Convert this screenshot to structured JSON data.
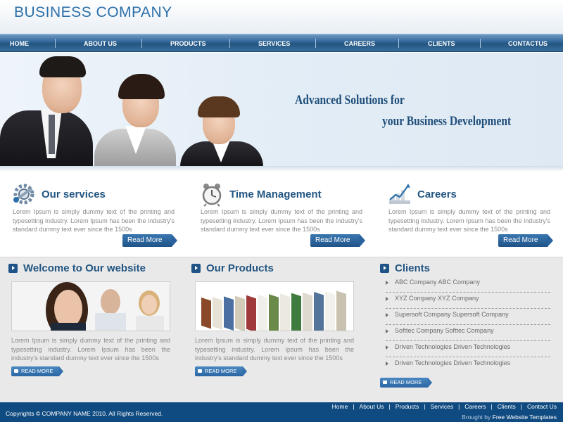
{
  "brand": {
    "title": "BUSINESS COMPANY"
  },
  "nav": {
    "items": [
      {
        "label": "HOME"
      },
      {
        "label": "ABOUT US"
      },
      {
        "label": "PRODUCTS"
      },
      {
        "label": "SERVICES"
      },
      {
        "label": "CAREERS"
      },
      {
        "label": "CLIENTS"
      },
      {
        "label": "CONTACTUS"
      }
    ]
  },
  "banner": {
    "line1": "Advanced Solutions for",
    "line2": "your Business Development"
  },
  "services": [
    {
      "title": "Our services",
      "icon": "gear-wrench-icon",
      "text": "Lorem Ipsum is simply dummy text of the printing and typesetting industry. Lorem Ipsum has been the industry's standard dummy text ever since the 1500s",
      "button": "Read More"
    },
    {
      "title": "Time Management",
      "icon": "alarm-clock-icon",
      "text": "Lorem Ipsum is simply dummy text of the printing and typesetting industry. Lorem Ipsum has been the industry's standard dummy text ever since the 1500s",
      "button": "Read More"
    },
    {
      "title": "Careers",
      "icon": "growth-chart-icon",
      "text": "Lorem Ipsum is simply dummy text of the printing and typesetting industry. Lorem Ipsum has been the industry's standard dummy text ever since the 1500s",
      "button": "Read More"
    }
  ],
  "welcome": {
    "title": "Welcome to Our website",
    "text": "Lorem Ipsum is simply dummy text of the printing and typesetting industry. Lorem Ipsum has been the industry's standard dummy text ever since the 1500s",
    "button": "READ MORE"
  },
  "products": {
    "title": "Our Products",
    "text": "Lorem Ipsum is simply dummy text of the printing and typesetting industry. Lorem Ipsum has been the industry's standard dummy text ever since the 1500s",
    "button": "READ MORE"
  },
  "clients": {
    "title": "Clients",
    "items": [
      {
        "label": "ABC Company ABC Company"
      },
      {
        "label": "XYZ Company XYZ Company"
      },
      {
        "label": "Supersoft Company Supersoft Company"
      },
      {
        "label": "Softtec Company Softtec Company"
      },
      {
        "label": "Driven Technologies Driven Technologies"
      },
      {
        "label": "Driven Technologies Driven Technologies"
      }
    ],
    "button": "READ MORE"
  },
  "footer": {
    "copyright": "Copyrights © COMPANY NAME 2010. All Rights Reserved.",
    "links": [
      {
        "label": "Home"
      },
      {
        "label": "About Us"
      },
      {
        "label": "Products"
      },
      {
        "label": "Services"
      },
      {
        "label": "Careers"
      },
      {
        "label": "Clients"
      },
      {
        "label": "Contact Us"
      }
    ],
    "brought_prefix": "Brought by",
    "brought_name": "Free Website Templates"
  },
  "colors": {
    "brand_blue": "#2c6fa9",
    "nav_blue": "#2f6496",
    "heading_blue": "#215581",
    "footer_blue": "#0f4a80",
    "section_grey": "#e9e9e9"
  }
}
